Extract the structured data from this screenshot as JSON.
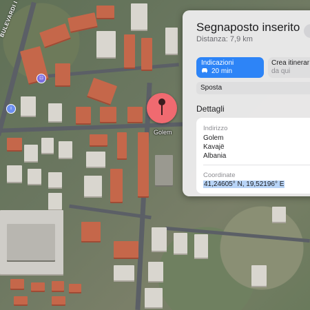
{
  "map": {
    "street_label": "BULEVARDI I PISHAVE",
    "pin_label": "Golem",
    "icons": [
      "dropped-pin-icon",
      "car-icon",
      "bus-poi-icon",
      "info-poi-icon"
    ]
  },
  "panel": {
    "title": "Segnaposto inserito",
    "distance": "Distanza: 7,9 km",
    "directions_button": {
      "label": "Indicazioni",
      "subtitle": "20 min"
    },
    "route_button": {
      "label": "Crea itinerar",
      "subtitle": "da qui"
    },
    "move_button": {
      "label": "Sposta"
    },
    "details_title": "Dettagli",
    "address_heading": "Indirizzo",
    "address_lines": [
      "Golem",
      "Kavajë",
      "Albania"
    ],
    "coordinates_heading": "Coordinate",
    "coordinates": "41,24605° N, 19,52196° E"
  },
  "colors": {
    "accent": "#2d84f7",
    "pin": "#f06a70",
    "selection": "#b8d4f7"
  }
}
